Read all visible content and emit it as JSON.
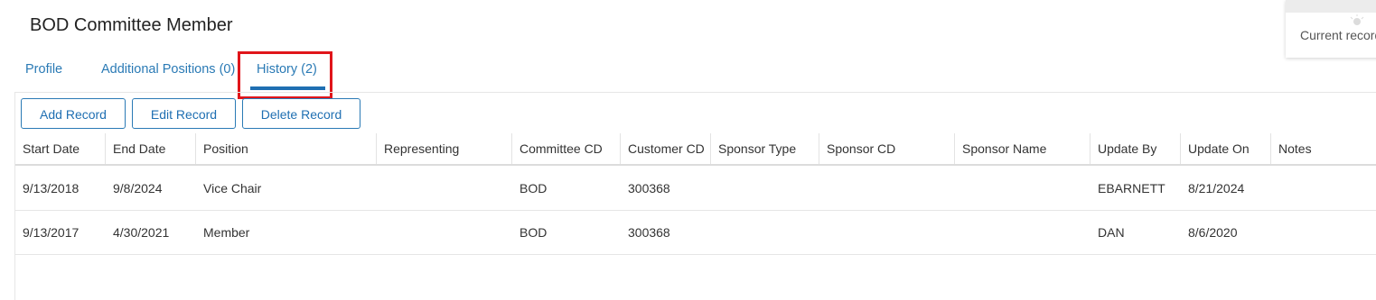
{
  "page": {
    "title": "BOD Committee Member"
  },
  "tabs": [
    {
      "label": "Profile"
    },
    {
      "label": "Additional Positions (0)"
    },
    {
      "label": "History (2)",
      "active": true
    }
  ],
  "toolbar": {
    "add_label": "Add Record",
    "edit_label": "Edit Record",
    "delete_label": "Delete Record"
  },
  "table": {
    "headers": [
      "Start Date",
      "End Date",
      "Position",
      "Representing",
      "Committee CD",
      "Customer CD",
      "Sponsor Type",
      "Sponsor CD",
      "Sponsor Name",
      "Update By",
      "Update On",
      "Notes"
    ],
    "rows": [
      [
        "9/13/2018",
        "9/8/2024",
        "Vice Chair",
        "",
        "BOD",
        "300368",
        "",
        "",
        "",
        "EBARNETT",
        "8/21/2024",
        ""
      ],
      [
        "9/13/2017",
        "4/30/2021",
        "Member",
        "",
        "BOD",
        "300368",
        "",
        "",
        "",
        "DAN",
        "8/6/2020",
        ""
      ]
    ]
  },
  "corner_card": {
    "text": "Current record",
    "icon": "lightbulb-icon"
  },
  "colors": {
    "accent": "#1f6fb2",
    "link": "#2a7ab5",
    "highlight": "#e0151a"
  }
}
